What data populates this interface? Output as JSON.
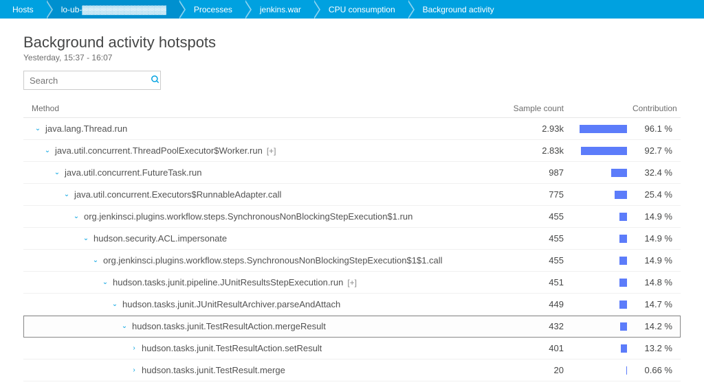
{
  "breadcrumbs": [
    {
      "label": "Hosts"
    },
    {
      "label": "lo-ub-▓▓▓▓▓▓▓▓▓▓▓▓▓▓"
    },
    {
      "label": "Processes"
    },
    {
      "label": "jenkins.war"
    },
    {
      "label": "CPU consumption"
    },
    {
      "label": "Background activity"
    }
  ],
  "page_title": "Background activity hotspots",
  "time_range": "Yesterday, 15:37 - 16:07",
  "search_placeholder": "Search",
  "headers": {
    "method": "Method",
    "sample": "Sample count",
    "contrib": "Contribution"
  },
  "rows": [
    {
      "depth": 0,
      "state": "open",
      "method": "java.lang.Thread.run",
      "plus": false,
      "sample": "2.93k",
      "pct": 96.1,
      "selected": false
    },
    {
      "depth": 1,
      "state": "open",
      "method": "java.util.concurrent.ThreadPoolExecutor$Worker.run",
      "plus": true,
      "sample": "2.83k",
      "pct": 92.7,
      "selected": false
    },
    {
      "depth": 2,
      "state": "open",
      "method": "java.util.concurrent.FutureTask.run",
      "plus": false,
      "sample": "987",
      "pct": 32.4,
      "selected": false
    },
    {
      "depth": 3,
      "state": "open",
      "method": "java.util.concurrent.Executors$RunnableAdapter.call",
      "plus": false,
      "sample": "775",
      "pct": 25.4,
      "selected": false
    },
    {
      "depth": 4,
      "state": "open",
      "method": "org.jenkinsci.plugins.workflow.steps.SynchronousNonBlockingStepExecution$1.run",
      "plus": false,
      "sample": "455",
      "pct": 14.9,
      "selected": false
    },
    {
      "depth": 5,
      "state": "open",
      "method": "hudson.security.ACL.impersonate",
      "plus": false,
      "sample": "455",
      "pct": 14.9,
      "selected": false
    },
    {
      "depth": 6,
      "state": "open",
      "method": "org.jenkinsci.plugins.workflow.steps.SynchronousNonBlockingStepExecution$1$1.call",
      "plus": false,
      "sample": "455",
      "pct": 14.9,
      "selected": false
    },
    {
      "depth": 7,
      "state": "open",
      "method": "hudson.tasks.junit.pipeline.JUnitResultsStepExecution.run",
      "plus": true,
      "sample": "451",
      "pct": 14.8,
      "selected": false
    },
    {
      "depth": 8,
      "state": "open",
      "method": "hudson.tasks.junit.JUnitResultArchiver.parseAndAttach",
      "plus": false,
      "sample": "449",
      "pct": 14.7,
      "selected": false
    },
    {
      "depth": 9,
      "state": "open",
      "method": "hudson.tasks.junit.TestResultAction.mergeResult",
      "plus": false,
      "sample": "432",
      "pct": 14.2,
      "selected": true
    },
    {
      "depth": 10,
      "state": "closed",
      "method": "hudson.tasks.junit.TestResultAction.setResult",
      "plus": false,
      "sample": "401",
      "pct": 13.2,
      "selected": false
    },
    {
      "depth": 10,
      "state": "closed",
      "method": "hudson.tasks.junit.TestResult.merge",
      "plus": false,
      "sample": "20",
      "pct": 0.66,
      "selected": false
    }
  ],
  "colors": {
    "bar": "#5c7cfa",
    "accent": "#00a1e0"
  }
}
